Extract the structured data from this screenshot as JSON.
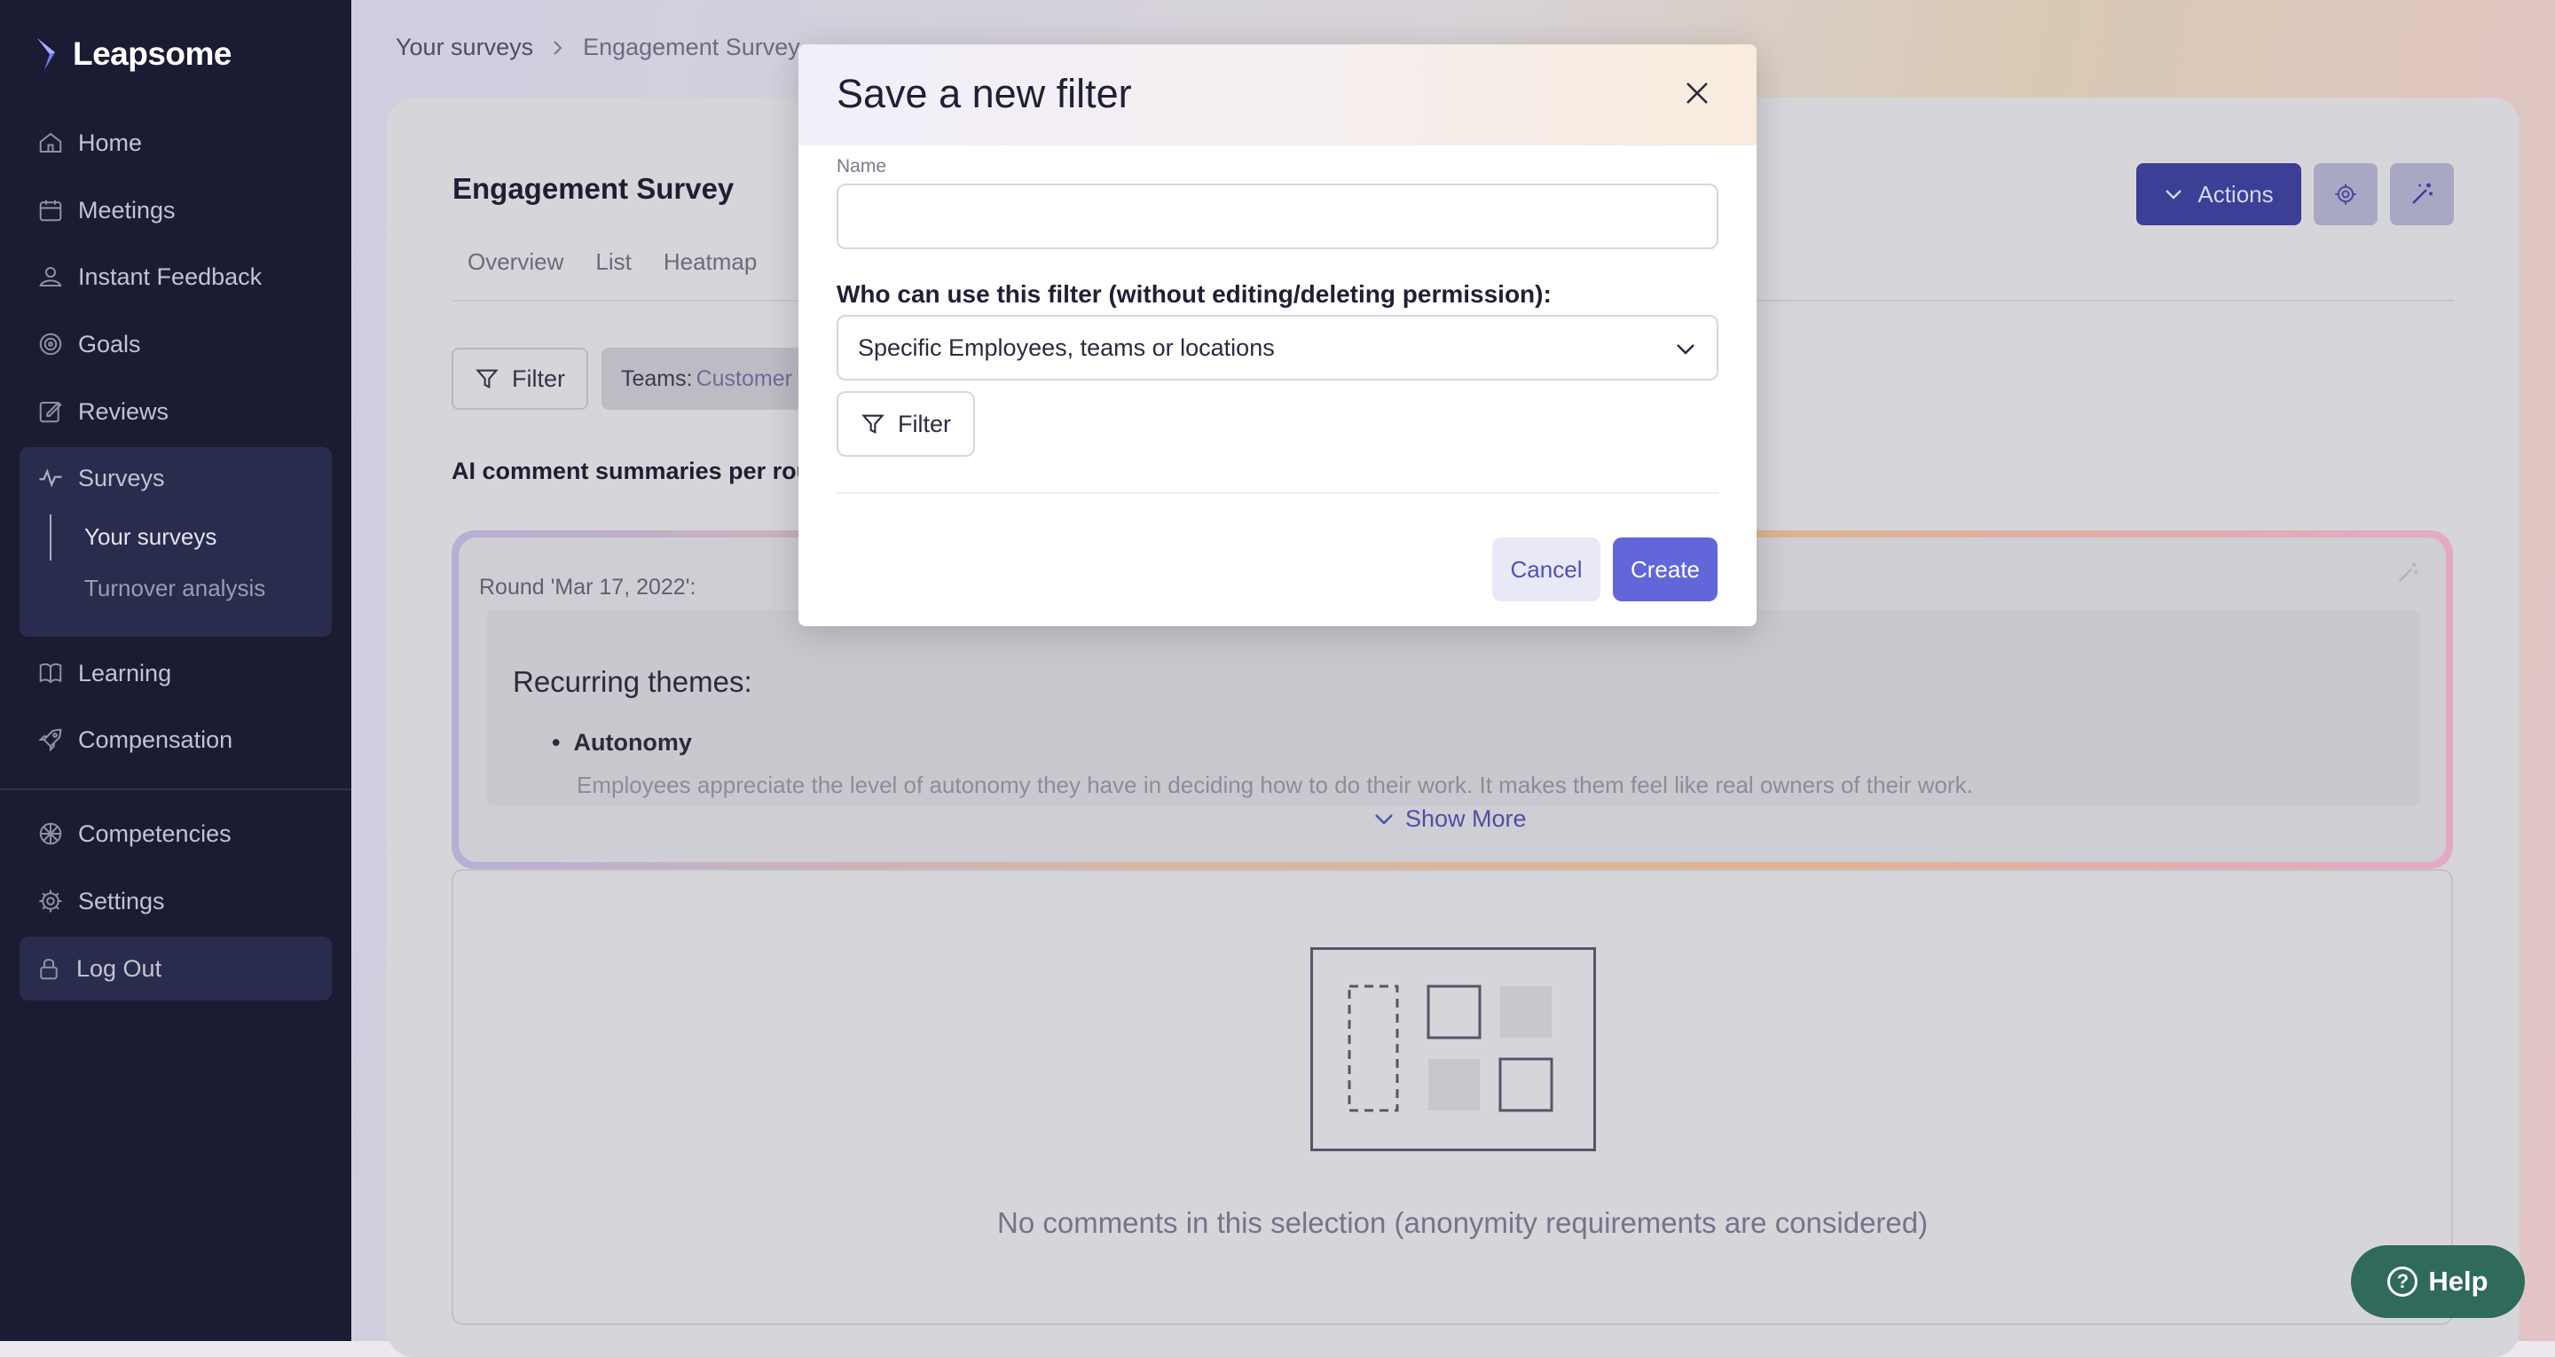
{
  "brand": {
    "name": "Leapsome"
  },
  "sidebar": {
    "items": [
      {
        "label": "Home",
        "icon": "home-icon"
      },
      {
        "label": "Meetings",
        "icon": "meetings-icon"
      },
      {
        "label": "Instant Feedback",
        "icon": "feedback-icon"
      },
      {
        "label": "Goals",
        "icon": "goals-icon"
      },
      {
        "label": "Reviews",
        "icon": "reviews-icon"
      },
      {
        "label": "Surveys",
        "icon": "surveys-icon"
      },
      {
        "label": "Learning",
        "icon": "book-icon"
      },
      {
        "label": "Compensation",
        "icon": "rocket-icon"
      },
      {
        "label": "Competencies",
        "icon": "competencies-icon"
      },
      {
        "label": "Settings",
        "icon": "gear-icon"
      },
      {
        "label": "Log Out",
        "icon": "lock-icon"
      }
    ],
    "surveys_sub": [
      "Your surveys",
      "Turnover analysis"
    ]
  },
  "breadcrumb": {
    "items": [
      "Your surveys",
      "Engagement Survey"
    ]
  },
  "page": {
    "title": "Engagement Survey",
    "tabs": [
      "Overview",
      "List",
      "Heatmap"
    ],
    "actions_label": "Actions",
    "filter_label": "Filter",
    "teams_chip_key": "Teams:",
    "teams_chip_value": "Customer",
    "ai_title": "AI comment summaries per roun",
    "round_label": "Round 'Mar 17, 2022':",
    "themes_heading": "Recurring themes:",
    "theme_bullet": "Autonomy",
    "theme_text": "Employees appreciate the level of autonomy they have in deciding how to do their work. It makes them feel like real owners of their work.",
    "show_more": "Show More",
    "empty_text": "No comments in this selection (anonymity requirements are considered)",
    "help_label": "Help"
  },
  "modal": {
    "title": "Save a new filter",
    "name_label": "Name",
    "name_value": "",
    "who_label": "Who can use this filter (without editing/deleting permission):",
    "select_value": "Specific Employees, teams or locations",
    "filter_label": "Filter",
    "cancel_label": "Cancel",
    "create_label": "Create"
  },
  "colors": {
    "sidebar_bg": "#1b1c33",
    "primary": "#6166d8",
    "help_bg": "#2f6a5b"
  }
}
